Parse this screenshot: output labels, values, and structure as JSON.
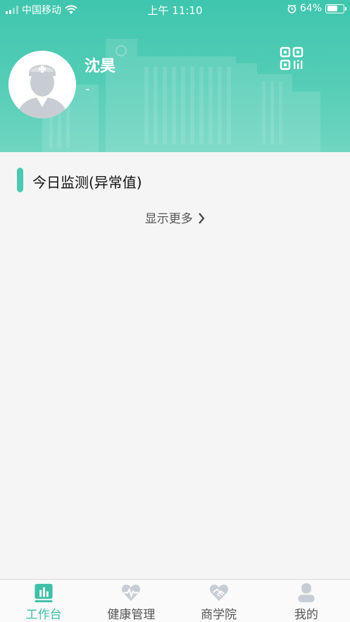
{
  "status_bar": {
    "carrier": "中国移动",
    "time": "上午 11:10",
    "battery": "64%"
  },
  "profile": {
    "name": "沈昊",
    "subtitle": "-"
  },
  "section": {
    "title": "今日监测(异常值)",
    "show_more": "显示更多"
  },
  "tabs": [
    {
      "label": "工作台",
      "icon": "dashboard-icon",
      "active": true
    },
    {
      "label": "健康管理",
      "icon": "heart-pulse-icon",
      "active": false
    },
    {
      "label": "商学院",
      "icon": "handshake-icon",
      "active": false
    },
    {
      "label": "我的",
      "icon": "person-icon",
      "active": false
    }
  ],
  "colors": {
    "primary": "#3fbfa8",
    "header_start": "#3fc6ae",
    "header_end": "#6fd6c1",
    "inactive_icon": "#c7cdd4",
    "background": "#f5f5f5"
  }
}
